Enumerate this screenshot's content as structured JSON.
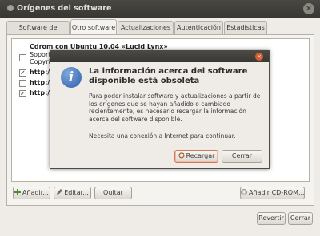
{
  "window": {
    "title": "Orígenes del software",
    "close_glyph": "×"
  },
  "tabs": [
    {
      "label": "Software de Ubuntu",
      "active": false
    },
    {
      "label": "Otro software",
      "active": true
    },
    {
      "label": "Actualizaciones",
      "active": false
    },
    {
      "label": "Autenticación",
      "active": false
    },
    {
      "label": "Estadísticas",
      "active": false
    }
  ],
  "sources": {
    "cdrom_title": "Cdrom con Ubuntu 10.04 «Lucid Lynx»",
    "cdrom_line1": "Soportad",
    "cdrom_line2": "Copyrigh",
    "items": [
      {
        "text": "http://a",
        "checked": true
      },
      {
        "text": "http://a",
        "checked": false
      },
      {
        "text": "http://a",
        "checked": true
      }
    ]
  },
  "buttons": {
    "add": "Añadir...",
    "edit": "Editar...",
    "remove": "Quitar",
    "add_cdrom": "Añadir CD-ROM...",
    "revert": "Revertir",
    "close": "Cerrar"
  },
  "dialog": {
    "title": "La información acerca del software disponible está obsoleta",
    "body": "Para poder instalar software y actualizaciones a partir de los orígenes que se hayan añadido o cambiado recientemente, es necesario recargar la información acerca del software disponible.",
    "body2": "Necesita una conexión a Internet para continuar.",
    "reload": "Recargar",
    "cancel": "Cerrar",
    "info_glyph": "i",
    "close_glyph": "×"
  },
  "colors": {
    "accent": "#d07a55",
    "info_blue": "#2e5ea8",
    "titlebar": "#3c3b37"
  },
  "icons": [
    "info-icon",
    "add-icon",
    "edit-icon",
    "cdrom-icon",
    "refresh-icon",
    "close-icon",
    "window-icon"
  ]
}
